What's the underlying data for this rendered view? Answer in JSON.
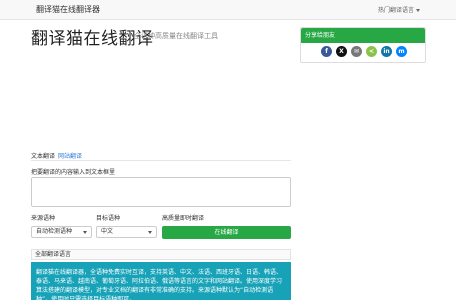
{
  "nav": {
    "brand": "翻译猫在线翻译器",
    "menu_label": "热门翻译语言"
  },
  "header": {
    "title": "翻译猫在线翻译",
    "subtitle": "全语种高质量在线翻译工具"
  },
  "share": {
    "title": "分享给朋友",
    "icons": [
      {
        "name": "facebook-icon",
        "glyph": "f",
        "color": "#3b5998"
      },
      {
        "name": "x-icon",
        "glyph": "X",
        "color": "#111111"
      },
      {
        "name": "email-icon",
        "glyph": "✉",
        "color": "#777777"
      },
      {
        "name": "sharethis-icon",
        "glyph": "<",
        "color": "#8bc34a"
      },
      {
        "name": "linkedin-icon",
        "glyph": "in",
        "color": "#0e76a8"
      },
      {
        "name": "messenger-icon",
        "glyph": "m",
        "color": "#0084ff"
      }
    ]
  },
  "tabs": {
    "text": "文本翻译",
    "web": "网站翻译"
  },
  "form": {
    "input_label": "把要翻译的内容输入到文本框里",
    "input_value": "",
    "source_label": "来源语种",
    "target_label": "目标语种",
    "quality_label": "高质量即时翻译",
    "source_value": "自动检测语种",
    "target_value": "中文",
    "translate_button": "在线翻译"
  },
  "languages_header": "全部翻译语言",
  "info_text": "翻译猫在线翻译器，全语种免费实时互译，支持英语、中文、法语、西班牙语、日语、韩语、泰语、马来语、越南语、葡萄牙语、阿拉伯语、俄语等语言的文字和网站翻译。使用深度学习算法搭建的翻译模型，对专业文档的翻译有非常准确的支持。来源语种默认为“自动检测语种”，使用时只需选择目标语种即可。"
}
